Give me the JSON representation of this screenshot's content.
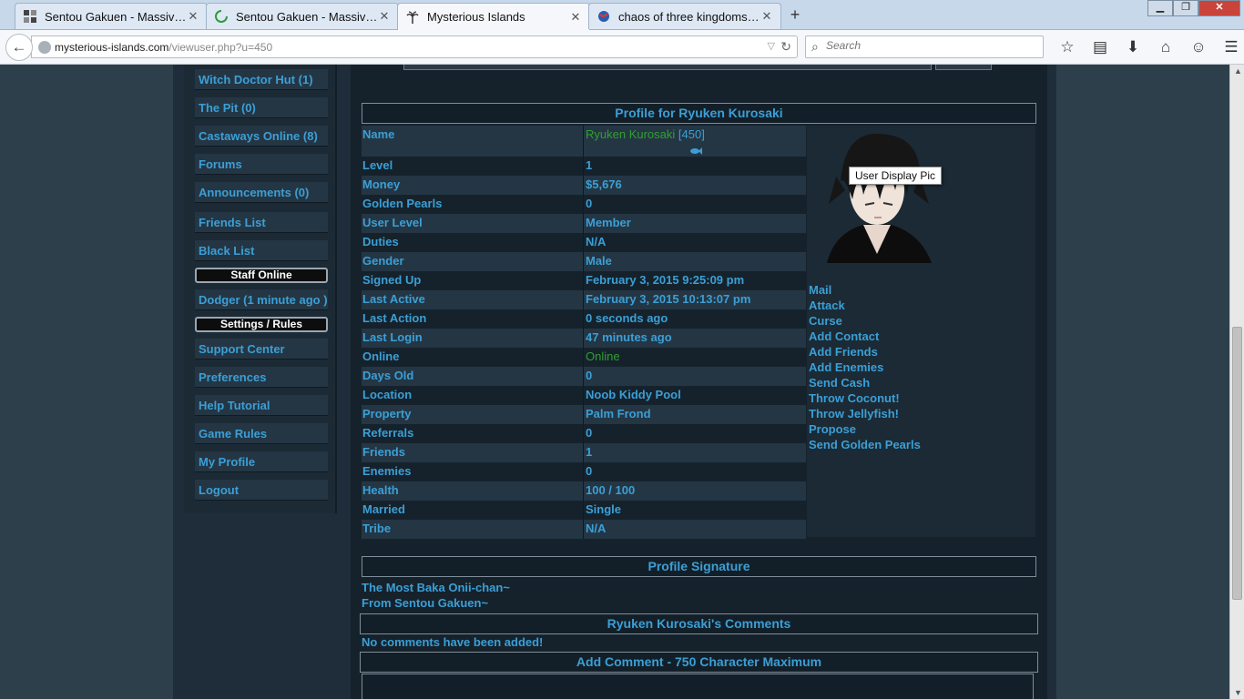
{
  "browser": {
    "tabs": [
      {
        "title": "Sentou Gakuen - Massive ...",
        "icon": "grid-favicon"
      },
      {
        "title": "Sentou Gakuen - Massive ...",
        "icon": "loading-spinner-icon"
      },
      {
        "title": "Mysterious Islands",
        "icon": "palm-tree-icon"
      },
      {
        "title": "chaos of three kingdoms b...",
        "icon": "globe-favicon"
      }
    ],
    "url_domain": "mysterious-islands.com",
    "url_path": "/viewuser.php?u=450",
    "search_placeholder": "Search"
  },
  "sidebar": {
    "items_top": [
      "Witch Doctor Hut (1)",
      "The Pit (0)",
      "Castaways Online (8)",
      "Forums",
      "Announcements (0)",
      "Friends List",
      "Black List"
    ],
    "staff_header": "Staff Online",
    "staff_item": "Dodger (1 minute ago )",
    "settings_header": "Settings / Rules",
    "items_bottom": [
      "Support Center",
      "Preferences",
      "Help Tutorial",
      "Game Rules",
      "My Profile",
      "Logout"
    ]
  },
  "profile": {
    "title": "Profile for Ryuken Kurosaki",
    "name_value": "Ryuken Kurosaki",
    "name_id": "[450]",
    "fields": [
      {
        "label": "Level",
        "value": "1"
      },
      {
        "label": "Money",
        "value": "$5,676"
      },
      {
        "label": "Golden Pearls",
        "value": "0"
      },
      {
        "label": "User Level",
        "value": "Member"
      },
      {
        "label": "Duties",
        "value": "N/A"
      },
      {
        "label": "Gender",
        "value": "Male"
      },
      {
        "label": "Signed Up",
        "value": "February 3, 2015 9:25:09 pm"
      },
      {
        "label": "Last Active",
        "value": "February 3, 2015 10:13:07 pm"
      },
      {
        "label": "Last Action",
        "value": "0 seconds ago"
      },
      {
        "label": "Last Login",
        "value": "47 minutes ago"
      },
      {
        "label": "Online",
        "value": "Online"
      },
      {
        "label": "Days Old",
        "value": "0"
      },
      {
        "label": "Location",
        "value": "Noob Kiddy Pool"
      },
      {
        "label": "Property",
        "value": "Palm Frond"
      },
      {
        "label": "Referrals",
        "value": "0"
      },
      {
        "label": "Friends",
        "value": "1"
      },
      {
        "label": "Enemies",
        "value": "0"
      },
      {
        "label": "Health",
        "value": "100 / 100"
      },
      {
        "label": "Married",
        "value": "Single"
      },
      {
        "label": "Tribe",
        "value": "N/A"
      }
    ],
    "name_label": "Name",
    "avatar_tooltip": "User Display Pic",
    "actions": [
      "Mail",
      "Attack",
      "Curse",
      "Add Contact",
      "Add Friends",
      "Add Enemies",
      "Send Cash",
      "Throw Coconut!",
      "Throw Jellyfish!",
      "Propose",
      "Send Golden Pearls"
    ]
  },
  "signature": {
    "title": "Profile Signature",
    "line1": "The Most Baka Onii-chan~",
    "line2": "From Sentou Gakuen~"
  },
  "comments": {
    "title": "Ryuken Kurosaki's Comments",
    "empty": "No comments have been added!",
    "add_title": "Add Comment - 750 Character Maximum"
  },
  "colors": {
    "link": "#3b9fd6",
    "online": "#2fa02f",
    "background": "#2e3f4c"
  }
}
